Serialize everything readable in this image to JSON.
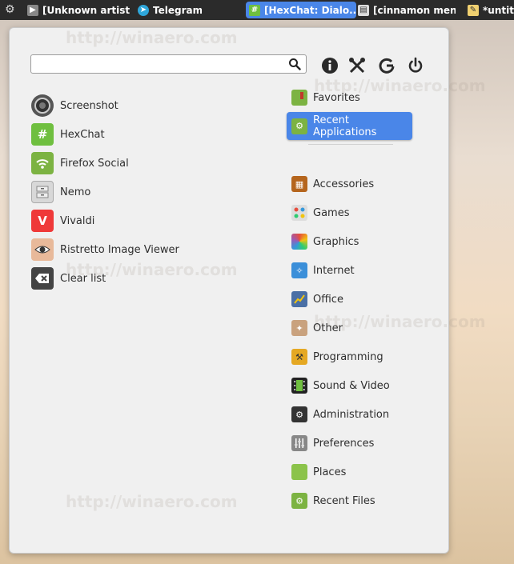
{
  "taskbar": {
    "items": [
      {
        "label": "[Unknown artist..."
      },
      {
        "label": "Telegram"
      },
      {
        "label": "[HexChat: Dialo..."
      },
      {
        "label": "[cinnamon menu]"
      },
      {
        "label": "*untitle"
      }
    ]
  },
  "menu": {
    "search": {
      "placeholder": "",
      "value": ""
    },
    "system_buttons": [
      "info-icon",
      "settings-tools-icon",
      "logout-icon",
      "power-icon"
    ],
    "apps": [
      {
        "label": "Screenshot",
        "icon": "camera-icon"
      },
      {
        "label": "HexChat",
        "icon": "hexchat-icon"
      },
      {
        "label": "Firefox Social",
        "icon": "wifi-icon"
      },
      {
        "label": "Nemo",
        "icon": "file-cabinet-icon"
      },
      {
        "label": "Vivaldi",
        "icon": "vivaldi-icon"
      },
      {
        "label": "Ristretto Image Viewer",
        "icon": "eye-icon"
      },
      {
        "label": "Clear list",
        "icon": "clear-icon"
      }
    ],
    "categories": [
      {
        "label": "Favorites",
        "icon": "favorites-icon"
      },
      {
        "label": "Recent Applications",
        "icon": "recent-folder-icon",
        "selected": true
      },
      {
        "label": "Accessories",
        "icon": "calculator-icon"
      },
      {
        "label": "Games",
        "icon": "games-icon"
      },
      {
        "label": "Graphics",
        "icon": "graphics-icon"
      },
      {
        "label": "Internet",
        "icon": "internet-icon"
      },
      {
        "label": "Office",
        "icon": "office-icon"
      },
      {
        "label": "Other",
        "icon": "other-icon"
      },
      {
        "label": "Programming",
        "icon": "programming-icon"
      },
      {
        "label": "Sound & Video",
        "icon": "film-icon"
      },
      {
        "label": "Administration",
        "icon": "admin-icon"
      },
      {
        "label": "Preferences",
        "icon": "sliders-icon"
      },
      {
        "label": "Places",
        "icon": "folder-icon"
      },
      {
        "label": "Recent Files",
        "icon": "recent-folder-icon"
      }
    ]
  },
  "colors": {
    "accent": "#4a86e8",
    "taskbar": "#2b2b2b",
    "panel": "#f0f0f0"
  },
  "watermark": "http://winaero.com"
}
